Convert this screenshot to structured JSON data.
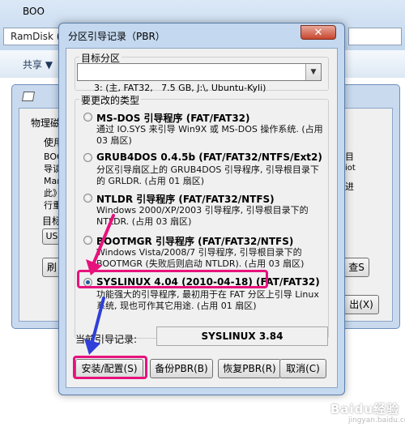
{
  "explorer": {
    "address": "RamDisk (",
    "share_label": "共享 ▼"
  },
  "bootice": {
    "title": "BOO",
    "tab_label": "物理磁",
    "use_label": "使用",
    "text_lines": [
      "BOO",
      "导读",
      "Mar",
      "此》",
      "行重"
    ],
    "right_text_lines": [
      "目",
      "iot",
      "进"
    ],
    "target_label": "目标",
    "target_value": "US",
    "refresh_btn": "刷",
    "view_btn": "查S",
    "exit_btn": "出(X)"
  },
  "dialog": {
    "title": "分区引导记录（PBR）",
    "close_symbol": "✕",
    "target_group_label": "目标分区",
    "target_partition": "3: (主, FAT32,   7.5 GB, J:\\, Ubuntu-Kyli)",
    "type_group_label": "要更改的类型",
    "options": [
      {
        "title": "MS-DOS 引导程序 (FAT/FAT32)",
        "desc": "通过 IO.SYS 来引导 Win9X 或 MS-DOS 操作系统. (占用 03 扇区)",
        "checked": false
      },
      {
        "title": "GRUB4DOS 0.4.5b (FAT/FAT32/NTFS/Ext2)",
        "desc": "分区引导扇区上的 GRUB4DOS 引导程序, 引导根目录下的 GRLDR. (占用 01 扇区)",
        "checked": false
      },
      {
        "title": "NTLDR 引导程序 (FAT/FAT32/NTFS)",
        "desc": "Windows 2000/XP/2003 引导程序, 引导根目录下的 NTLDR. (占用 03 扇区)",
        "checked": false
      },
      {
        "title": "BOOTMGR 引导程序 (FAT/FAT32/NTFS)",
        "desc": "Windows Vista/2008/7 引导程序, 引导根目录下的 BOOTMGR (失败后则启动 NTLDR). (占用 03 扇区)",
        "checked": false
      },
      {
        "title": "SYSLINUX 4.04 (2010-04-18) (FAT/FAT32)",
        "desc": "功能强大的引导程序, 最初用于在 FAT 分区上引导 Linux 系统, 现也可作其它用途. (占用 01 扇区)",
        "checked": true
      }
    ],
    "current_label": "当前引导记录:",
    "current_value": "SYSLINUX 3.84",
    "buttons": {
      "install": "安装/配置(S)",
      "backup": "备份PBR(B)",
      "restore": "恢复PBR(R)",
      "cancel": "取消(C)"
    }
  },
  "annotation": {
    "highlight_color": "#e6137c",
    "arrow_color": "#e6137c",
    "arrow2_color": "#2f3fd8"
  },
  "watermark": {
    "text": "Baidu经验",
    "sub": "jingyan.baidu.com"
  }
}
